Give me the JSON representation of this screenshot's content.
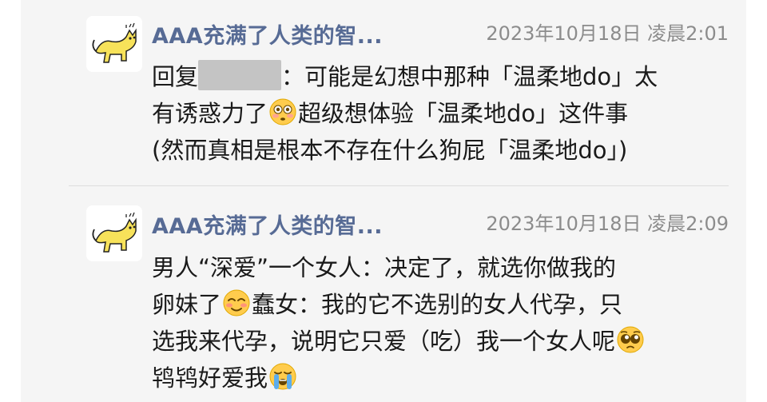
{
  "colors": {
    "username": "#576b95",
    "timestamp": "#8c8c8c",
    "text": "#1a1a1a",
    "card_background": "#f5f5f5",
    "redaction": "#c4c4c4",
    "avatar_cat": "#f7e25a"
  },
  "posts": [
    {
      "avatar_icon": "yellow-cat-avatar",
      "username": "AAA充满了人类的智...",
      "timestamp": "2023年10月18日 凌晨2:01",
      "lines": [
        {
          "reply_prefix": "回复",
          "reply_suffix": "：可能是幻想中那种「温柔地do」太"
        },
        {
          "before_emoji": "有诱惑力了",
          "emoji": "flushed-face-emoji",
          "after_emoji": "超级想体验「温柔地do」这件事"
        },
        {
          "text": "(然而真相是根本不存在什么狗屁「温柔地do」)"
        }
      ]
    },
    {
      "avatar_icon": "yellow-cat-avatar",
      "username": "AAA充满了人类的智...",
      "timestamp": "2023年10月18日 凌晨2:09",
      "lines": [
        {
          "text": "男人“深爱”一个女人：决定了，就选你做我的"
        },
        {
          "before_emoji": "卵妹了",
          "emoji": "smiling-blush-emoji",
          "after_emoji": "蠢女：我的它不选别的女人代孕，只"
        },
        {
          "before_emoji": "选我来代孕，说明它只爱（吃）我一个女人呢",
          "emoji": "pleading-face-emoji",
          "after_emoji": ""
        },
        {
          "before_emoji": "鸨鸨好爱我",
          "emoji": "crying-face-emoji",
          "after_emoji": ""
        }
      ]
    }
  ]
}
